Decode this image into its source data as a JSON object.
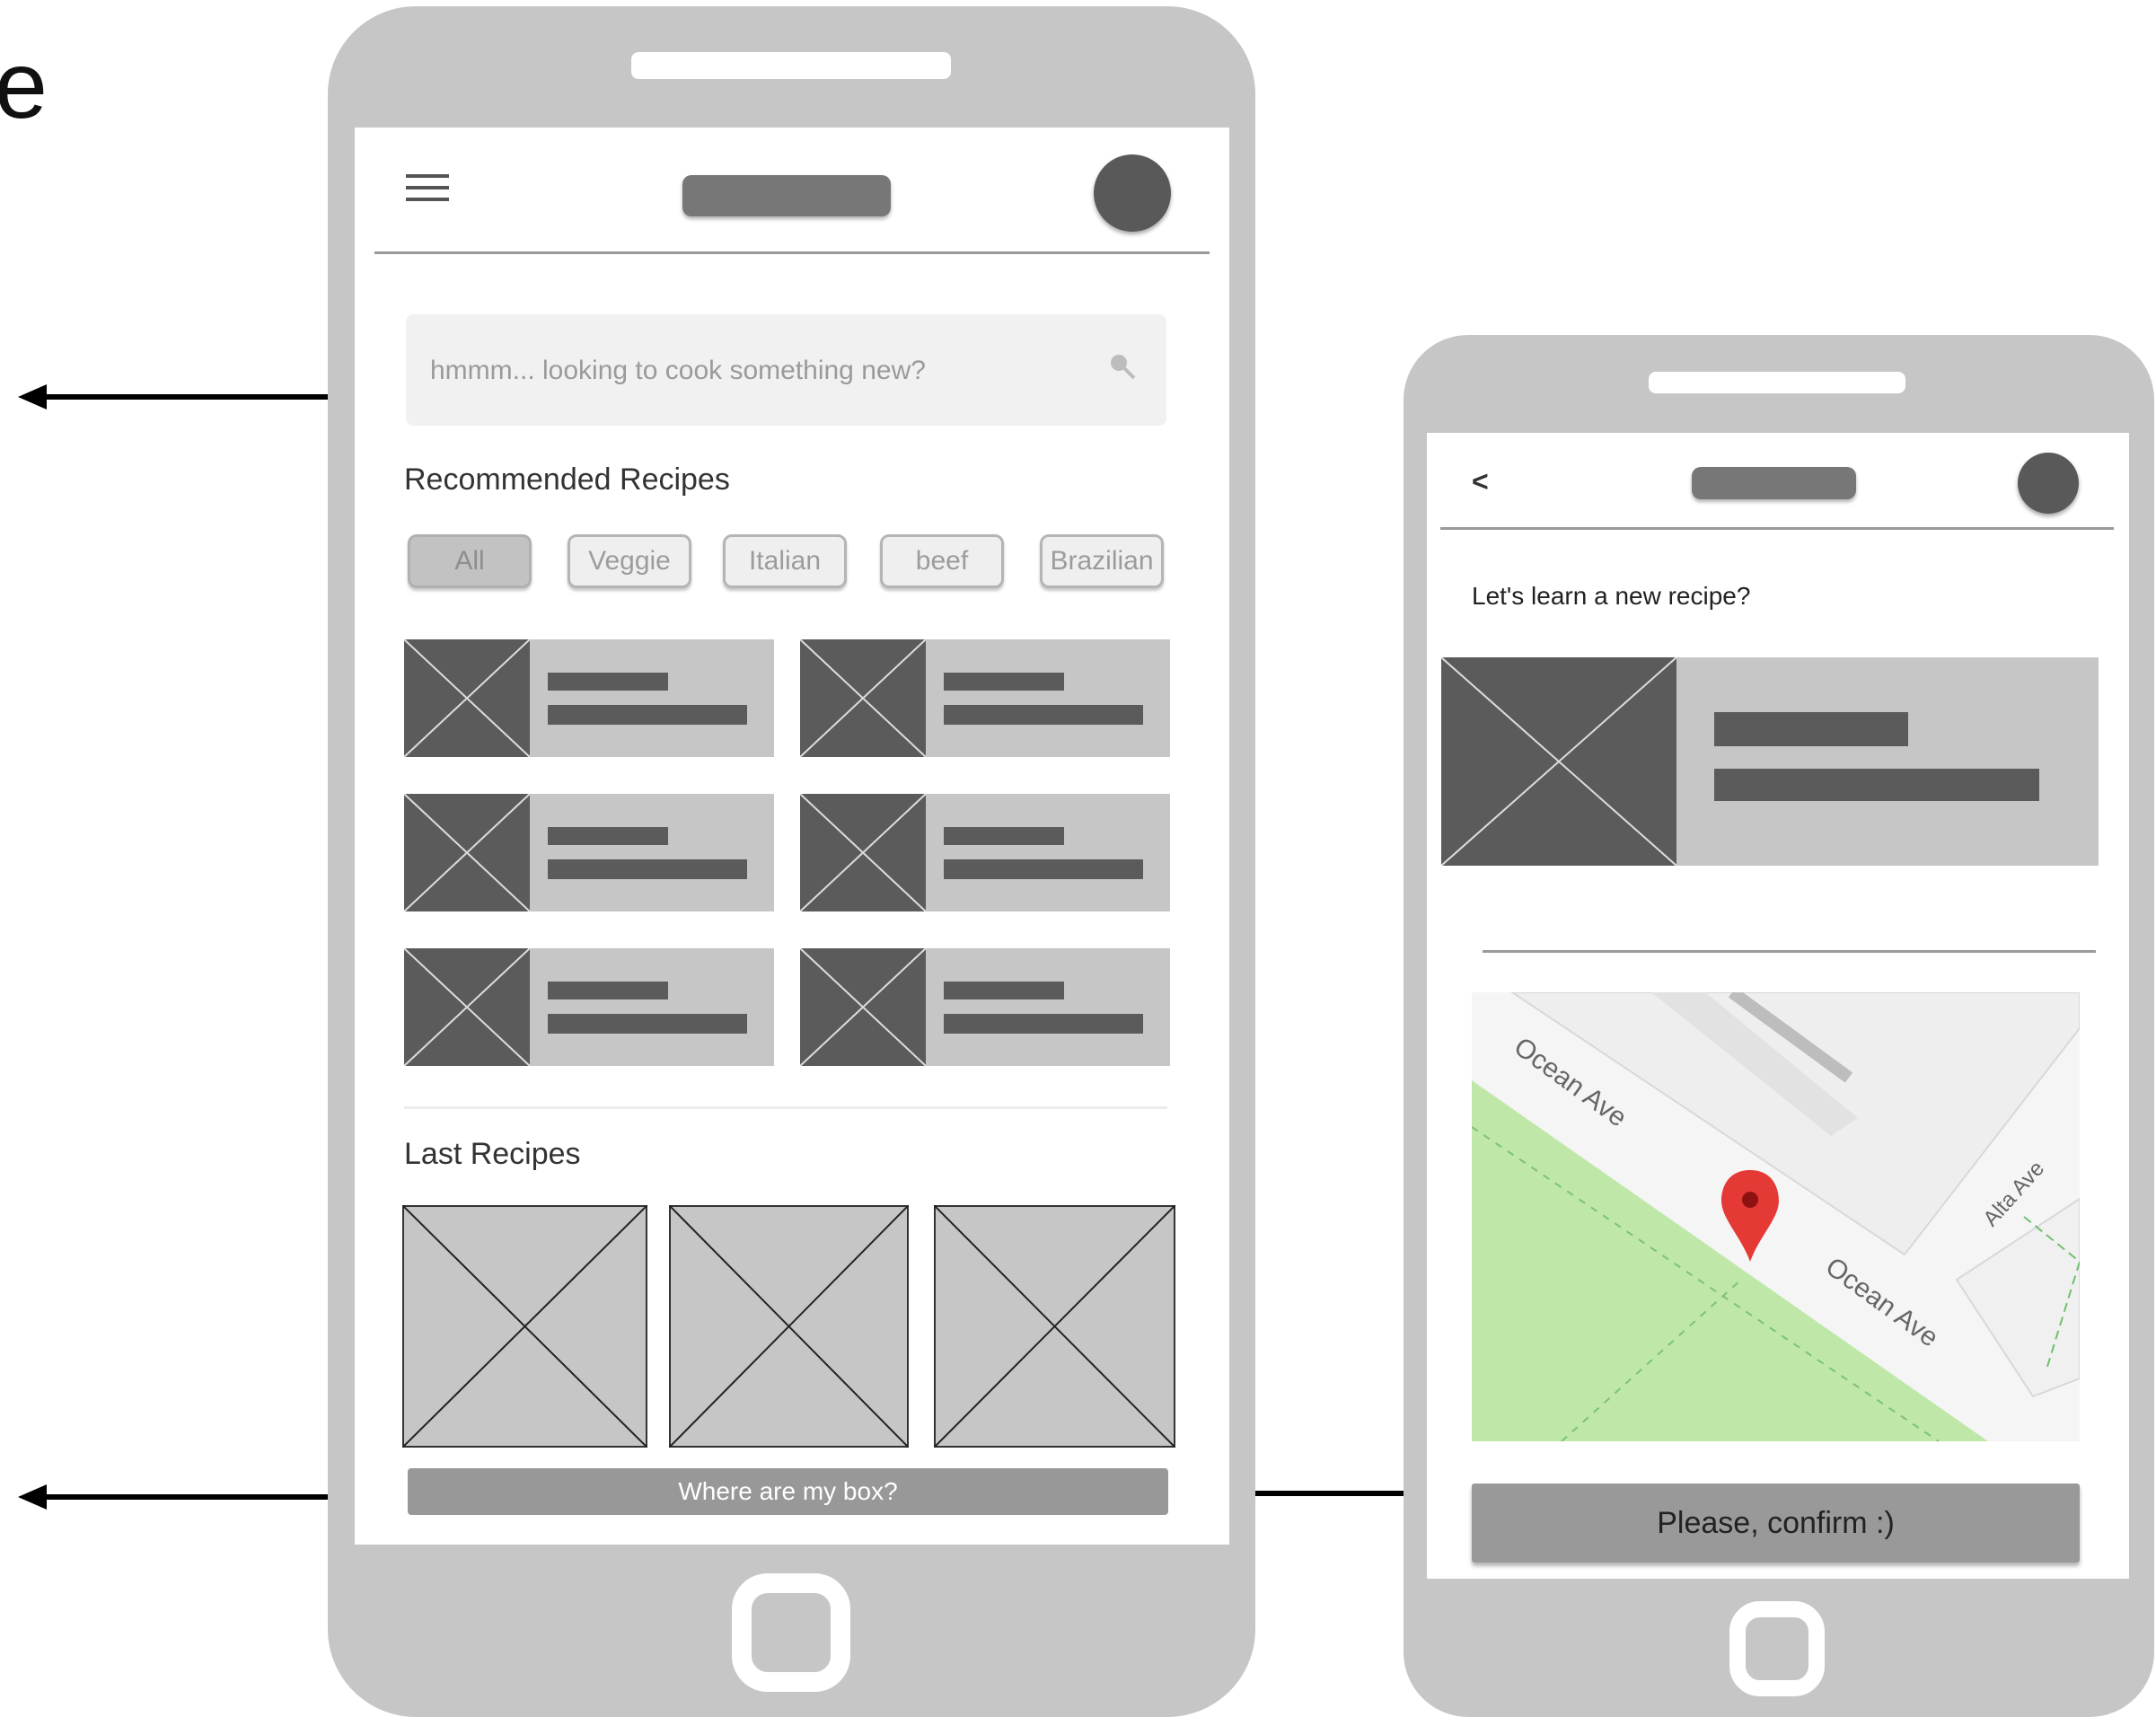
{
  "partial_heading": "e",
  "main_screen": {
    "search": {
      "placeholder": "hmmm... looking to cook something new?"
    },
    "recommended": {
      "title": "Recommended Recipes",
      "chips": [
        {
          "label": "All",
          "active": true
        },
        {
          "label": "Veggie",
          "active": false
        },
        {
          "label": "Italian",
          "active": false
        },
        {
          "label": "beef",
          "active": false
        },
        {
          "label": "Brazilian",
          "active": false
        }
      ]
    },
    "last": {
      "title": "Last Recipes"
    },
    "action_button": "Where are my box?"
  },
  "detail_screen": {
    "back_label": "<",
    "prompt": "Let's learn a new recipe?",
    "map": {
      "street_labels": [
        "Ocean Ave",
        "Ocean Ave",
        "Alta Ave"
      ],
      "pin_color": "#e53935",
      "park_color": "#bfe8a8"
    },
    "confirm_button": "Please, confirm :)"
  },
  "colors": {
    "device": "#c6c6c6",
    "placeholder_dark": "#5b5b5b",
    "button_gray": "#989898"
  }
}
